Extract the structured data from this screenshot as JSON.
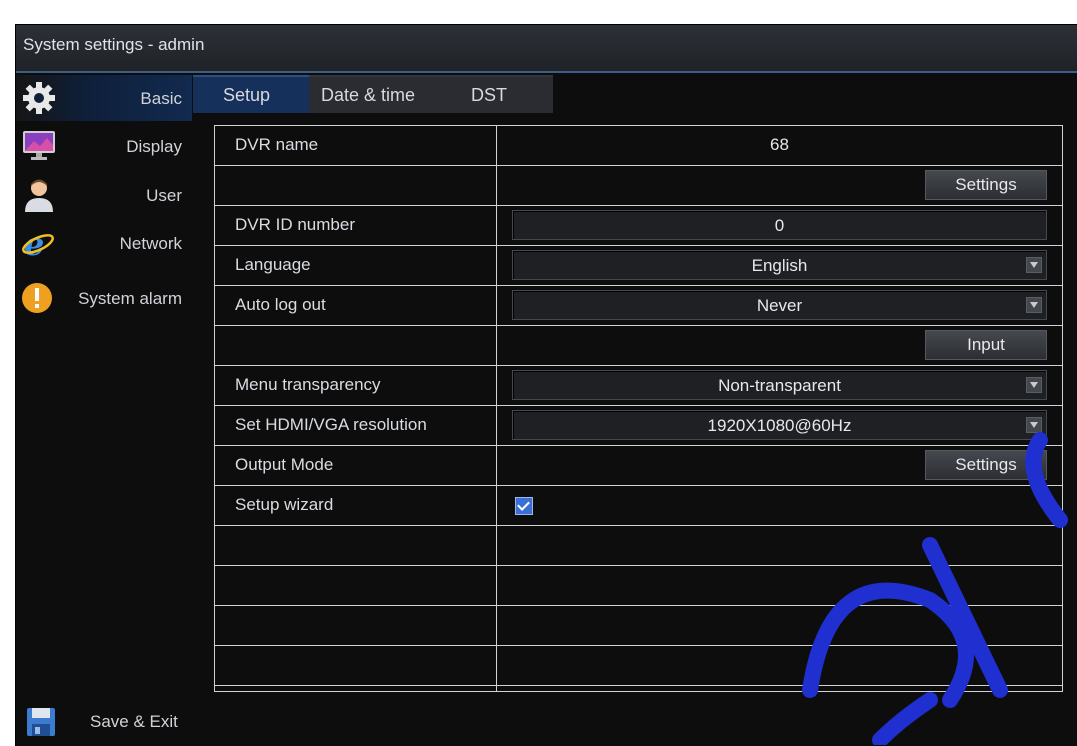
{
  "window": {
    "title": "System settings - admin"
  },
  "sidebar": {
    "items": [
      {
        "label": "Basic",
        "icon": "gear-icon",
        "selected": true
      },
      {
        "label": "Display",
        "icon": "monitor-icon"
      },
      {
        "label": "User",
        "icon": "user-icon"
      },
      {
        "label": "Network",
        "icon": "internet-explorer-icon"
      },
      {
        "label": "System alarm",
        "icon": "warning-icon"
      }
    ],
    "save_label": "Save & Exit"
  },
  "tabs": [
    {
      "label": "Setup",
      "active": true
    },
    {
      "label": "Date & time"
    },
    {
      "label": "DST"
    }
  ],
  "settings": {
    "dvr_name": {
      "label": "DVR name",
      "value": "68"
    },
    "name_settings_button": "Settings",
    "dvr_id": {
      "label": "DVR ID number",
      "value": "0"
    },
    "language": {
      "label": "Language",
      "value": "English"
    },
    "auto_logout": {
      "label": "Auto log out",
      "value": "Never"
    },
    "input_button": "Input",
    "menu_transparency": {
      "label": "Menu transparency",
      "value": "Non-transparent"
    },
    "resolution": {
      "label": "Set HDMI/VGA resolution",
      "value": "1920X1080@60Hz"
    },
    "output_mode": {
      "label": "Output Mode",
      "button": "Settings"
    },
    "setup_wizard": {
      "label": "Setup wizard",
      "checked": true
    }
  },
  "colors": {
    "accent": "#15305a",
    "background": "#0d0d0d",
    "checkbox": "#3a6fd6",
    "watermark": "#1f2fd0"
  }
}
